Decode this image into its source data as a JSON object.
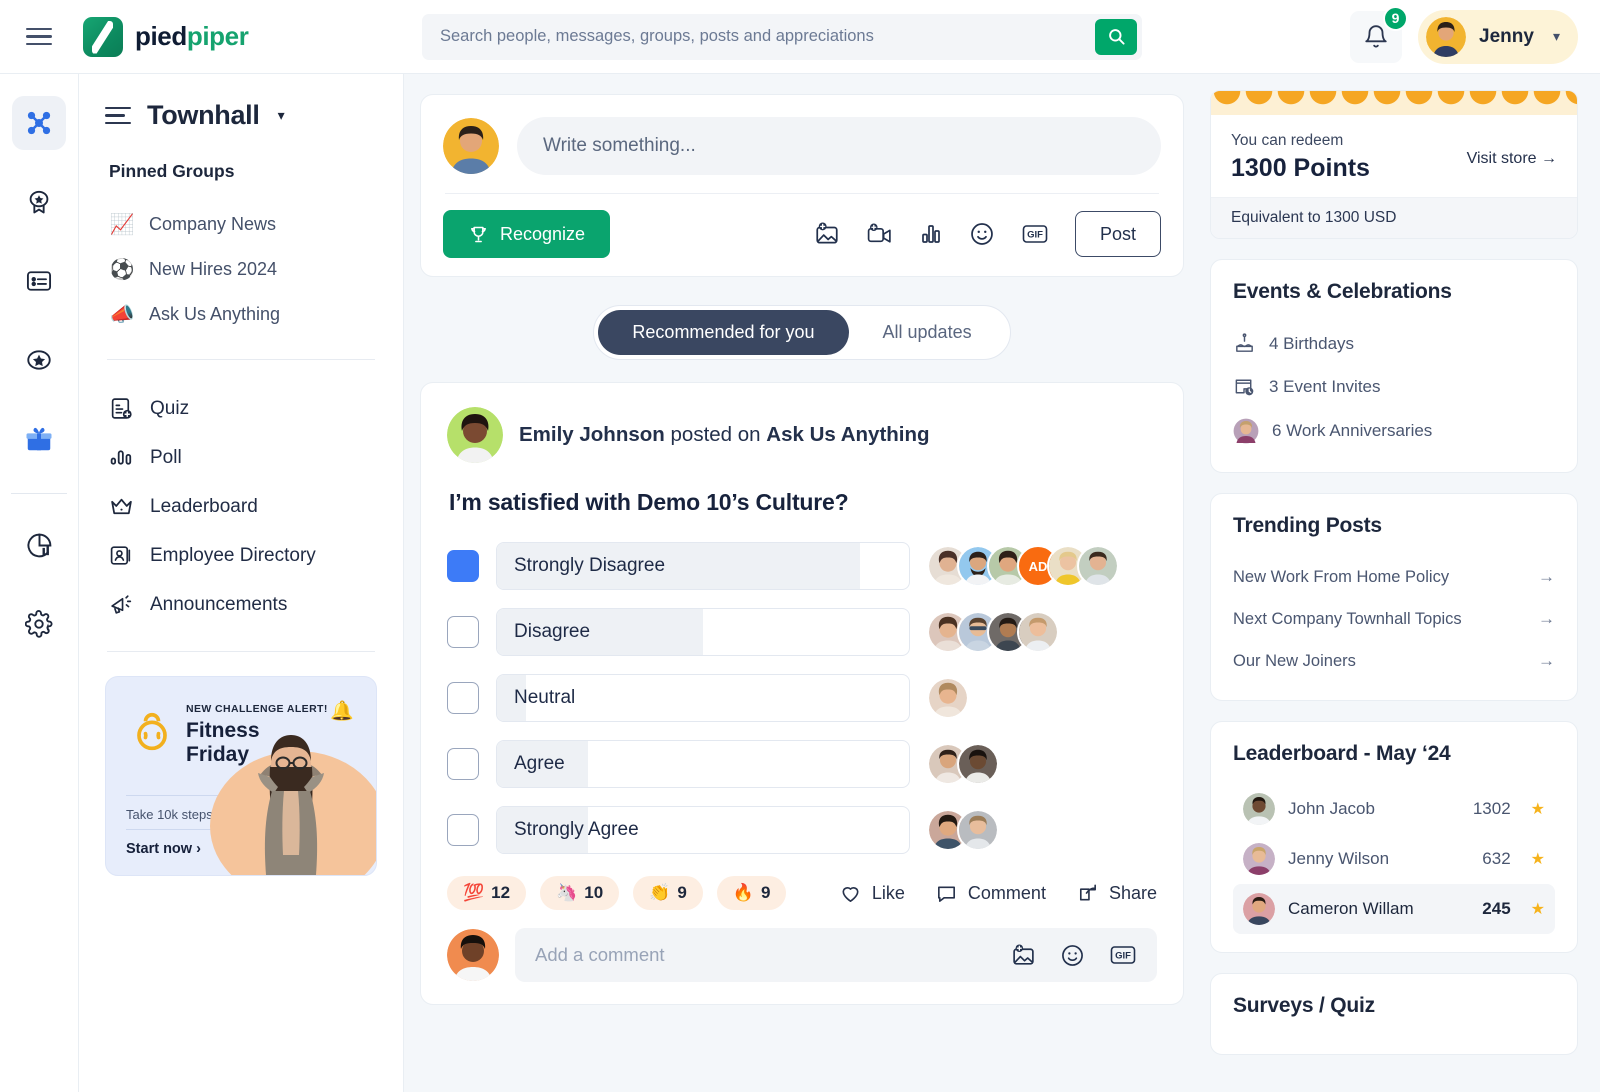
{
  "brand": {
    "name_a": "pied",
    "name_b": "piper"
  },
  "search": {
    "placeholder": "Search people, messages, groups, posts and appreciations",
    "value": "",
    "icon": "search-icon"
  },
  "header": {
    "menu_icon": "hamburger-icon",
    "notifications": {
      "icon": "bell-icon",
      "count": "9"
    },
    "user": {
      "name": "Jenny",
      "caret": "▾"
    }
  },
  "rail": {
    "items": [
      {
        "icon": "network-hub-icon",
        "active": true
      },
      {
        "icon": "award-badge-icon",
        "active": false
      },
      {
        "icon": "list-card-icon",
        "active": false
      },
      {
        "icon": "star-oval-icon",
        "active": false
      },
      {
        "icon": "gift-icon",
        "active": false
      },
      {
        "icon": "pie-chart-icon",
        "active": false
      },
      {
        "icon": "gear-icon",
        "active": false
      }
    ]
  },
  "sidebar": {
    "menu_icon": "sidebar-menu-icon",
    "title": "Townhall",
    "title_caret": "▾",
    "pinned_label": "Pinned Groups",
    "pinned": [
      {
        "emoji": "📈",
        "label": "Company News"
      },
      {
        "emoji": "⚽",
        "label": "New Hires 2024"
      },
      {
        "emoji": "📣",
        "label": "Ask Us Anything"
      }
    ],
    "menu": [
      {
        "icon": "quiz-icon",
        "label": "Quiz"
      },
      {
        "icon": "poll-icon",
        "label": "Poll"
      },
      {
        "icon": "crown-icon",
        "label": "Leaderboard"
      },
      {
        "icon": "employee-directory-icon",
        "label": "Employee Directory"
      },
      {
        "icon": "megaphone-icon",
        "label": "Announcements"
      }
    ],
    "promo": {
      "alert": "NEW CHALLENGE ALERT!",
      "title_line1": "Fitness",
      "title_line2": "Friday",
      "subtitle": "Take 10k steps today.",
      "cta": "Start now ›",
      "bell_emoji": "🔔",
      "icon": "kettlebell-icon"
    }
  },
  "composer": {
    "placeholder": "Write something...",
    "value": "",
    "recognize_label": "Recognize",
    "recognize_icon": "trophy-icon",
    "post_label": "Post",
    "tools": [
      {
        "icon": "add-image-icon"
      },
      {
        "icon": "add-video-icon"
      },
      {
        "icon": "poll-bar-icon"
      },
      {
        "icon": "emoji-icon"
      },
      {
        "icon": "gif-icon",
        "label": "GIF"
      }
    ]
  },
  "feed": {
    "tabs": [
      {
        "label": "Recommended for you",
        "active": true
      },
      {
        "label": "All updates",
        "active": false
      }
    ],
    "post": {
      "author": "Emily Johnson",
      "action": "posted on",
      "group": "Ask Us Anything",
      "question": "I’m satisfied with Demo 10’s Culture?",
      "reactions": [
        {
          "emoji": "💯",
          "count": "12"
        },
        {
          "emoji": "🦄",
          "count": "10"
        },
        {
          "emoji": "👏",
          "count": "9"
        },
        {
          "emoji": "🔥",
          "count": "9"
        }
      ],
      "actions": [
        {
          "icon": "heart-icon",
          "label": "Like"
        },
        {
          "icon": "comment-icon",
          "label": "Comment"
        },
        {
          "icon": "share-icon",
          "label": "Share"
        }
      ],
      "comment": {
        "placeholder": "Add a comment",
        "value": "",
        "tools": [
          {
            "icon": "add-image-icon"
          },
          {
            "icon": "emoji-icon"
          },
          {
            "icon": "gif-icon",
            "label": "GIF"
          }
        ]
      }
    }
  },
  "chart_data": {
    "type": "bar",
    "title": "I’m satisfied with Demo 10’s Culture?",
    "orientation": "horizontal",
    "categories": [
      "Strongly Disagree",
      "Disagree",
      "Neutral",
      "Agree",
      "Strongly Agree"
    ],
    "values": [
      88,
      50,
      7,
      22,
      22
    ],
    "unit": "percent-of-bar-width",
    "xlabel": "",
    "ylabel": "",
    "xlim": [
      0,
      100
    ],
    "grid": false,
    "legend": false,
    "selected_index": 0,
    "voter_counts": [
      6,
      4,
      1,
      2,
      2
    ],
    "voter_avatar_colors": [
      [
        "#d9cfc6",
        "#93c8ee",
        "#c9d7c3",
        "#f96b10",
        "#ead7b2",
        "#cfd8c8"
      ],
      [
        "#dcc6bb",
        "#b9c8da",
        "#6f6a67",
        "#d8cdc0"
      ],
      [
        "#e6d4c6"
      ],
      [
        "#d9c8bb",
        "#6a5f58"
      ],
      [
        "#caa79a",
        "#b9bcc0"
      ]
    ],
    "initials_badge": {
      "index": 3,
      "text": "AD",
      "color": "#f96b10"
    }
  },
  "rightbar": {
    "points": {
      "label": "You can redeem",
      "value": "1300 Points",
      "visit_store": "Visit store →",
      "equivalent": "Equivalent to 1300 USD"
    },
    "events": {
      "title": "Events & Celebrations",
      "items": [
        {
          "icon": "cake-icon",
          "label": "4 Birthdays"
        },
        {
          "icon": "calendar-clock-icon",
          "label": "3 Event Invites"
        },
        {
          "icon": "avatar-icon",
          "label": "6 Work Anniversaries"
        }
      ]
    },
    "trending": {
      "title": "Trending Posts",
      "items": [
        {
          "label": "New Work From Home Policy",
          "arrow": "→"
        },
        {
          "label": "Next Company Townhall Topics",
          "arrow": "→"
        },
        {
          "label": "Our New Joiners",
          "arrow": "→"
        }
      ]
    },
    "leaderboard": {
      "title": "Leaderboard - May ‘24",
      "rows": [
        {
          "name": "John Jacob",
          "points": "1302",
          "star": "★",
          "highlight": false
        },
        {
          "name": "Jenny Wilson",
          "points": "632",
          "star": "★",
          "highlight": false
        },
        {
          "name": "Cameron Willam",
          "points": "245",
          "star": "★",
          "highlight": true
        }
      ]
    },
    "surveys": {
      "title": "Surveys / Quiz"
    }
  },
  "colors": {
    "brand_green": "#16a36f",
    "accent_blue": "#3d7bf7",
    "tab_active": "#3a4761",
    "badge_green": "#00a76a",
    "star_gold": "#f6b31c",
    "scallop_orange": "#f5a623"
  }
}
